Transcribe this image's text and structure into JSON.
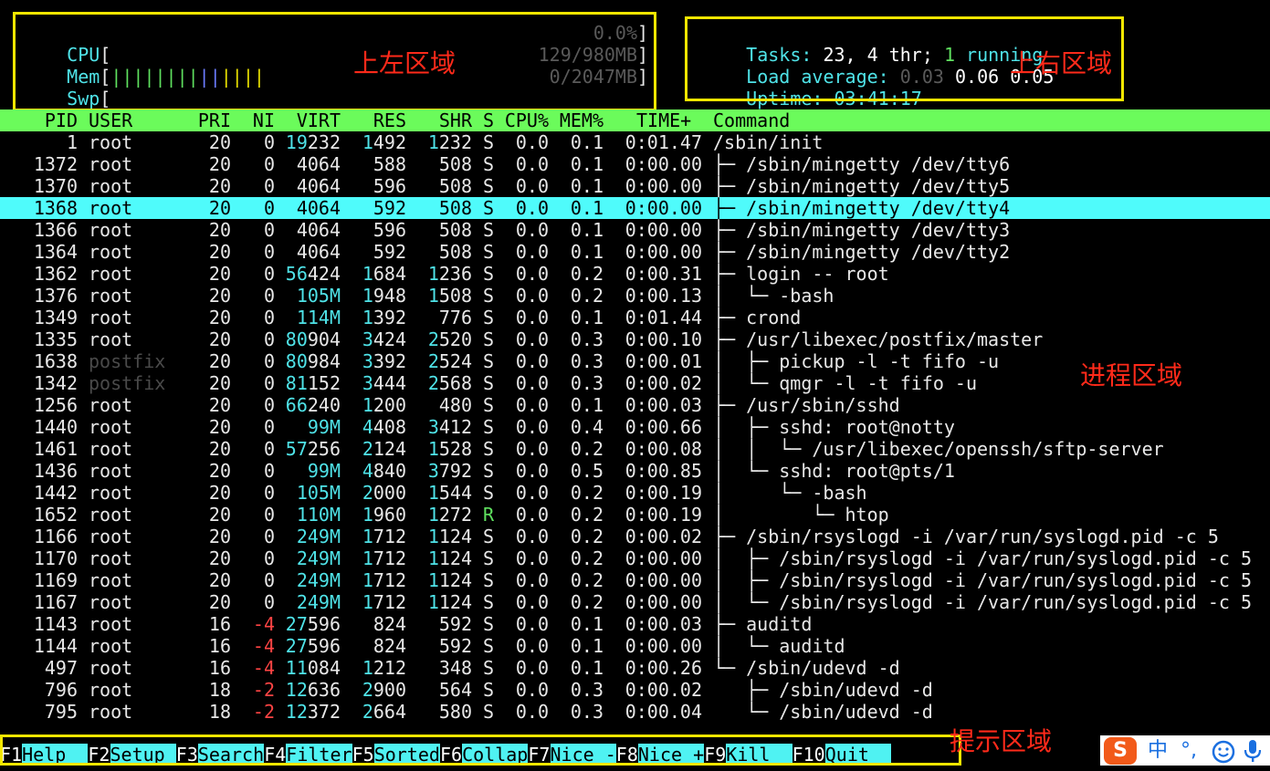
{
  "meters": {
    "cpu_label": "CPU",
    "cpu_value": "0.0%",
    "mem_label": "Mem",
    "mem_value": "129/980MB",
    "swp_label": "Swp",
    "swp_value": "0/2047MB"
  },
  "summary": {
    "tasks_label": "Tasks:",
    "tasks_count": "23,",
    "threads": "4 thr;",
    "running_count": "1",
    "running_label": "running",
    "load_label": "Load average:",
    "load_1": "0.03",
    "load_5": "0.06",
    "load_15": "0.05",
    "uptime_label": "Uptime:",
    "uptime_value": "03:41:17"
  },
  "annotations": {
    "top_left": "上左区域",
    "top_right": "上右区域",
    "process": "进程区域",
    "hint": "提示区域"
  },
  "columns": [
    "PID",
    "USER",
    "PRI",
    "NI",
    "VIRT",
    "RES",
    "SHR",
    "S",
    "CPU%",
    "MEM%",
    "TIME+",
    "Command"
  ],
  "processes": [
    {
      "pid": "1",
      "user": "root",
      "pri": "20",
      "ni": "0",
      "virt": "19232",
      "res": "1492",
      "shr": "1232",
      "s": "S",
      "cpu": "0.0",
      "mem": "0.1",
      "time": "0:01.47",
      "cmd": "/sbin/init"
    },
    {
      "pid": "1372",
      "user": "root",
      "pri": "20",
      "ni": "0",
      "virt": "4064",
      "res": "588",
      "shr": "508",
      "s": "S",
      "cpu": "0.0",
      "mem": "0.1",
      "time": "0:00.00",
      "cmd": "├─ /sbin/mingetty /dev/tty6"
    },
    {
      "pid": "1370",
      "user": "root",
      "pri": "20",
      "ni": "0",
      "virt": "4064",
      "res": "596",
      "shr": "508",
      "s": "S",
      "cpu": "0.0",
      "mem": "0.1",
      "time": "0:00.00",
      "cmd": "├─ /sbin/mingetty /dev/tty5"
    },
    {
      "pid": "1368",
      "user": "root",
      "pri": "20",
      "ni": "0",
      "virt": "4064",
      "res": "592",
      "shr": "508",
      "s": "S",
      "cpu": "0.0",
      "mem": "0.1",
      "time": "0:00.00",
      "cmd": "├─ /sbin/mingetty /dev/tty4",
      "selected": true
    },
    {
      "pid": "1366",
      "user": "root",
      "pri": "20",
      "ni": "0",
      "virt": "4064",
      "res": "596",
      "shr": "508",
      "s": "S",
      "cpu": "0.0",
      "mem": "0.1",
      "time": "0:00.00",
      "cmd": "├─ /sbin/mingetty /dev/tty3"
    },
    {
      "pid": "1364",
      "user": "root",
      "pri": "20",
      "ni": "0",
      "virt": "4064",
      "res": "592",
      "shr": "508",
      "s": "S",
      "cpu": "0.0",
      "mem": "0.1",
      "time": "0:00.00",
      "cmd": "├─ /sbin/mingetty /dev/tty2"
    },
    {
      "pid": "1362",
      "user": "root",
      "pri": "20",
      "ni": "0",
      "virt": "56424",
      "res": "1684",
      "shr": "1236",
      "s": "S",
      "cpu": "0.0",
      "mem": "0.2",
      "time": "0:00.31",
      "cmd": "├─ login -- root"
    },
    {
      "pid": "1376",
      "user": "root",
      "pri": "20",
      "ni": "0",
      "virt": "105M",
      "res": "1948",
      "shr": "1508",
      "s": "S",
      "cpu": "0.0",
      "mem": "0.2",
      "time": "0:00.13",
      "cmd": "│  └─ -bash"
    },
    {
      "pid": "1349",
      "user": "root",
      "pri": "20",
      "ni": "0",
      "virt": "114M",
      "res": "1392",
      "shr": "776",
      "s": "S",
      "cpu": "0.0",
      "mem": "0.1",
      "time": "0:01.44",
      "cmd": "├─ crond"
    },
    {
      "pid": "1335",
      "user": "root",
      "pri": "20",
      "ni": "0",
      "virt": "80904",
      "res": "3424",
      "shr": "2520",
      "s": "S",
      "cpu": "0.0",
      "mem": "0.3",
      "time": "0:00.10",
      "cmd": "├─ /usr/libexec/postfix/master"
    },
    {
      "pid": "1638",
      "user": "postfix",
      "pri": "20",
      "ni": "0",
      "virt": "80984",
      "res": "3392",
      "shr": "2524",
      "s": "S",
      "cpu": "0.0",
      "mem": "0.3",
      "time": "0:00.01",
      "cmd": "│  ├─ pickup -l -t fifo -u"
    },
    {
      "pid": "1342",
      "user": "postfix",
      "pri": "20",
      "ni": "0",
      "virt": "81152",
      "res": "3444",
      "shr": "2568",
      "s": "S",
      "cpu": "0.0",
      "mem": "0.3",
      "time": "0:00.02",
      "cmd": "│  └─ qmgr -l -t fifo -u"
    },
    {
      "pid": "1256",
      "user": "root",
      "pri": "20",
      "ni": "0",
      "virt": "66240",
      "res": "1200",
      "shr": "480",
      "s": "S",
      "cpu": "0.0",
      "mem": "0.1",
      "time": "0:00.03",
      "cmd": "├─ /usr/sbin/sshd"
    },
    {
      "pid": "1440",
      "user": "root",
      "pri": "20",
      "ni": "0",
      "virt": "99M",
      "res": "4408",
      "shr": "3412",
      "s": "S",
      "cpu": "0.0",
      "mem": "0.4",
      "time": "0:00.66",
      "cmd": "│  ├─ sshd: root@notty"
    },
    {
      "pid": "1461",
      "user": "root",
      "pri": "20",
      "ni": "0",
      "virt": "57256",
      "res": "2124",
      "shr": "1528",
      "s": "S",
      "cpu": "0.0",
      "mem": "0.2",
      "time": "0:00.08",
      "cmd": "│  │  └─ /usr/libexec/openssh/sftp-server"
    },
    {
      "pid": "1436",
      "user": "root",
      "pri": "20",
      "ni": "0",
      "virt": "99M",
      "res": "4840",
      "shr": "3792",
      "s": "S",
      "cpu": "0.0",
      "mem": "0.5",
      "time": "0:00.85",
      "cmd": "│  └─ sshd: root@pts/1"
    },
    {
      "pid": "1442",
      "user": "root",
      "pri": "20",
      "ni": "0",
      "virt": "105M",
      "res": "2000",
      "shr": "1544",
      "s": "S",
      "cpu": "0.0",
      "mem": "0.2",
      "time": "0:00.19",
      "cmd": "│     └─ -bash"
    },
    {
      "pid": "1652",
      "user": "root",
      "pri": "20",
      "ni": "0",
      "virt": "110M",
      "res": "1960",
      "shr": "1272",
      "s": "R",
      "cpu": "0.0",
      "mem": "0.2",
      "time": "0:00.19",
      "cmd": "│        └─ htop"
    },
    {
      "pid": "1166",
      "user": "root",
      "pri": "20",
      "ni": "0",
      "virt": "249M",
      "res": "1712",
      "shr": "1124",
      "s": "S",
      "cpu": "0.0",
      "mem": "0.2",
      "time": "0:00.02",
      "cmd": "├─ /sbin/rsyslogd -i /var/run/syslogd.pid -c 5"
    },
    {
      "pid": "1170",
      "user": "root",
      "pri": "20",
      "ni": "0",
      "virt": "249M",
      "res": "1712",
      "shr": "1124",
      "s": "S",
      "cpu": "0.0",
      "mem": "0.2",
      "time": "0:00.00",
      "cmd": "│  ├─ /sbin/rsyslogd -i /var/run/syslogd.pid -c 5"
    },
    {
      "pid": "1169",
      "user": "root",
      "pri": "20",
      "ni": "0",
      "virt": "249M",
      "res": "1712",
      "shr": "1124",
      "s": "S",
      "cpu": "0.0",
      "mem": "0.2",
      "time": "0:00.00",
      "cmd": "│  ├─ /sbin/rsyslogd -i /var/run/syslogd.pid -c 5"
    },
    {
      "pid": "1167",
      "user": "root",
      "pri": "20",
      "ni": "0",
      "virt": "249M",
      "res": "1712",
      "shr": "1124",
      "s": "S",
      "cpu": "0.0",
      "mem": "0.2",
      "time": "0:00.00",
      "cmd": "│  └─ /sbin/rsyslogd -i /var/run/syslogd.pid -c 5"
    },
    {
      "pid": "1143",
      "user": "root",
      "pri": "16",
      "ni": "-4",
      "virt": "27596",
      "res": "824",
      "shr": "592",
      "s": "S",
      "cpu": "0.0",
      "mem": "0.1",
      "time": "0:00.03",
      "cmd": "├─ auditd"
    },
    {
      "pid": "1144",
      "user": "root",
      "pri": "16",
      "ni": "-4",
      "virt": "27596",
      "res": "824",
      "shr": "592",
      "s": "S",
      "cpu": "0.0",
      "mem": "0.1",
      "time": "0:00.00",
      "cmd": "│  └─ auditd"
    },
    {
      "pid": "497",
      "user": "root",
      "pri": "16",
      "ni": "-4",
      "virt": "11084",
      "res": "1212",
      "shr": "348",
      "s": "S",
      "cpu": "0.0",
      "mem": "0.1",
      "time": "0:00.26",
      "cmd": "└─ /sbin/udevd -d"
    },
    {
      "pid": "796",
      "user": "root",
      "pri": "18",
      "ni": "-2",
      "virt": "12636",
      "res": "2900",
      "shr": "564",
      "s": "S",
      "cpu": "0.0",
      "mem": "0.3",
      "time": "0:00.02",
      "cmd": "   ├─ /sbin/udevd -d"
    },
    {
      "pid": "795",
      "user": "root",
      "pri": "18",
      "ni": "-2",
      "virt": "12372",
      "res": "2664",
      "shr": "580",
      "s": "S",
      "cpu": "0.0",
      "mem": "0.3",
      "time": "0:00.04",
      "cmd": "   └─ /sbin/udevd -d"
    }
  ],
  "footer": [
    {
      "key": "F1",
      "label": "Help  "
    },
    {
      "key": "F2",
      "label": "Setup "
    },
    {
      "key": "F3",
      "label": "Search"
    },
    {
      "key": "F4",
      "label": "Filter"
    },
    {
      "key": "F5",
      "label": "Sorted"
    },
    {
      "key": "F6",
      "label": "Collap"
    },
    {
      "key": "F7",
      "label": "Nice -"
    },
    {
      "key": "F8",
      "label": "Nice +"
    },
    {
      "key": "F9",
      "label": "Kill  "
    },
    {
      "key": "F10",
      "label": "Quit  "
    }
  ],
  "ime": {
    "logo": "S",
    "lang": "中",
    "punct": "°,",
    "emoji_icon": "smiley-icon",
    "mic_icon": "microphone-icon"
  },
  "colors": {
    "header_bg": "#6bfb5b",
    "selected_bg": "#4ffbfb",
    "annotation_box": "#f2e600",
    "annotation_text": "#ff2a1a",
    "cyan_text": "#4fe3e8",
    "negative_nice": "#ff4444",
    "running_state": "#5fe05f"
  }
}
